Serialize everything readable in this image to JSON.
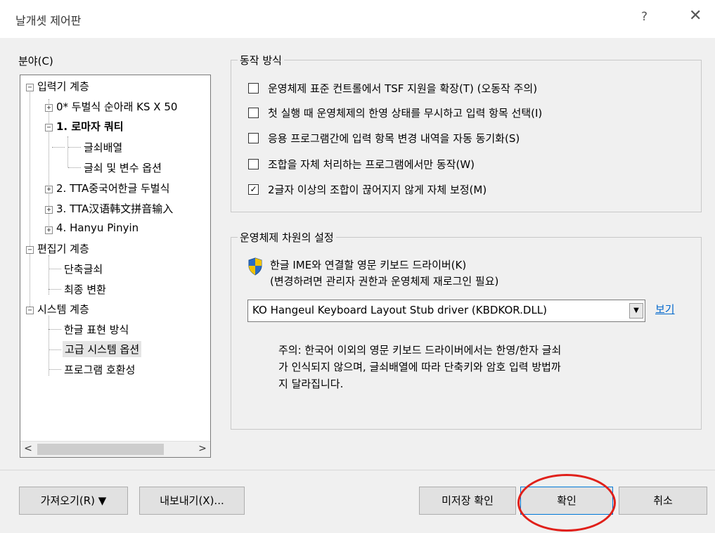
{
  "window": {
    "title": "날개셋 제어판",
    "help_glyph": "?",
    "close_glyph": "✕"
  },
  "left": {
    "heading": "분야(C)",
    "tree": [
      {
        "label": "입력기 계층",
        "expander": "−"
      },
      {
        "label": "0* 두벌식 순아래 KS X 50",
        "expander": "+"
      },
      {
        "label": "1. 로마자 쿼티",
        "expander": "−"
      },
      {
        "label": "글쇠배열",
        "expander": ""
      },
      {
        "label": "글쇠 및 변수 옵션",
        "expander": ""
      },
      {
        "label": "2. TTA중국어한글 두벌식",
        "expander": "+"
      },
      {
        "label": "3. TTA汉语韩文拼音输入",
        "expander": "+"
      },
      {
        "label": "4. Hanyu Pinyin",
        "expander": "+"
      },
      {
        "label": "편집기 계층",
        "expander": "−"
      },
      {
        "label": "단축글쇠",
        "expander": ""
      },
      {
        "label": "최종 변환",
        "expander": ""
      },
      {
        "label": "시스템 계층",
        "expander": "−"
      },
      {
        "label": "한글 표현 방식",
        "expander": ""
      },
      {
        "label": "고급 시스템 옵션",
        "expander": ""
      },
      {
        "label": "프로그램 호환성",
        "expander": ""
      }
    ],
    "scroll_left": "<",
    "scroll_right": ">"
  },
  "behavior": {
    "legend": "동작 방식",
    "options": [
      {
        "label": "운영체제 표준 컨트롤에서 TSF 지원을 확장(T) (오동작 주의)",
        "checked": false
      },
      {
        "label": "첫 실행 때 운영체제의 한영 상태를 무시하고 입력 항목 선택(I)",
        "checked": false
      },
      {
        "label": "응용 프로그램간에 입력 항목 변경 내역을 자동 동기화(S)",
        "checked": false
      },
      {
        "label": "조합을 자체 처리하는 프로그램에서만 동작(W)",
        "checked": false
      },
      {
        "label": "2글자 이상의 조합이 끊어지지 않게 자체 보정(M)",
        "checked": true
      }
    ],
    "check_glyph": "✓"
  },
  "os_settings": {
    "legend": "운영체제 차원의 설정",
    "driver_label_line1": "한글 IME와 연결할 영문 키보드 드라이버(K)",
    "driver_label_line2": "(변경하려면 관리자 권한과 운영체제 재로그인 필요)",
    "driver_selected": "KO Hangeul Keyboard Layout Stub driver (KBDKOR.DLL)",
    "dropdown_glyph": "▼",
    "view_link": "보기",
    "note_line1": "주의: 한국어 이외의 영문 키보드 드라이버에서는 한영/한자 글쇠",
    "note_line2": "가 인식되지 않으며, 글쇠배열에 따라 단축키와 암호 입력 방법까",
    "note_line3": "지 달라집니다."
  },
  "buttons": {
    "import": "가져오기(R) ▼",
    "export": "내보내기(X)...",
    "check_unsaved": "미저장 확인",
    "ok": "확인",
    "cancel": "취소"
  },
  "colors": {
    "highlight_circle": "#e0201a",
    "link": "#0066cc",
    "shield_blue": "#2a6cc4",
    "shield_yellow": "#f2c200"
  }
}
